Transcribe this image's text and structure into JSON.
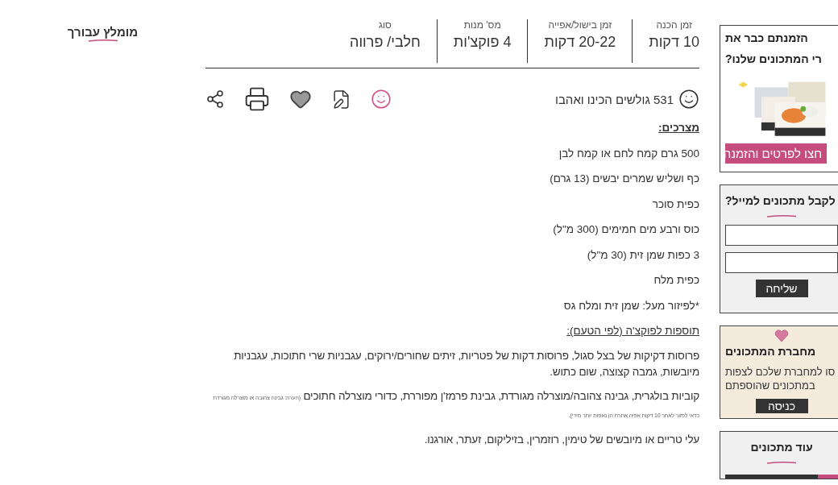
{
  "recommended": {
    "title": "מומלץ עבורך"
  },
  "stats": [
    {
      "label": "זמן הכנה",
      "value": "10 דקות"
    },
    {
      "label": "זמן בישול/אפייה",
      "value": "20-22 דקות"
    },
    {
      "label": "מס' מנות",
      "value": "4 פוקצ'ות"
    },
    {
      "label": "סוג",
      "value": "חלבי/ פרווה"
    }
  ],
  "likes": "531 גולשים הכינו ואהבו",
  "recipe": [
    {
      "kind": "heading",
      "text": "מצרכים:"
    },
    {
      "kind": "line",
      "text": "500 גרם קמח לחם או קמח לבן"
    },
    {
      "kind": "line",
      "text": "כף ושליש שמרים יבשים (13 גרם)"
    },
    {
      "kind": "line",
      "text": "כפית סוכר"
    },
    {
      "kind": "line",
      "text": "כוס ורבע מים חמימים (300 מ\"ל)"
    },
    {
      "kind": "line",
      "text": "3 כפות שמן זית (30 מ\"ל)"
    },
    {
      "kind": "line",
      "text": "כפית מלח"
    },
    {
      "kind": "line",
      "text": "*לפיזור מעל: שמן זית ומלח גס"
    },
    {
      "kind": "subheading",
      "text": "תוספות לפוקצ'ה (לפי הטעם):"
    },
    {
      "kind": "paragraph",
      "text": "פרוסות דקיקות של בצל סגול, פרוסות דקות של פטריות, זיתים שחורים/ירוקים, עגבניות שרי חתוכות, עגבניות מיובשות, גמבה קצוצה, שום כתוש."
    },
    {
      "kind": "paragraph",
      "text": "קוביות בולגרית, גבינה צהובה/מוצרלה מגורדת, גבינת פרמז'ן מפוררת, כדורי מוצרלה חתוכים",
      "note": "(הערה: גבינה צהובה או מוצרלה מגורדת כדאי לפזור לאחר 10 דקות אפיה אחרת הן נאפות יותר מידי)."
    },
    {
      "kind": "paragraph",
      "text": "עלי טריים או מיובשים של טימין, רוזמרין, בזיליקום, זעתר, אורגנו."
    }
  ],
  "sidebar": [
    {
      "kind": "promo",
      "title_lines": [
        "הזמנתם כבר את",
        "רי המתכונים שלנו?"
      ],
      "button": "חצו לפרטים והזמנה"
    },
    {
      "kind": "newsletter",
      "title": "לקבל מתכונים למייל?",
      "button": "שליחה"
    },
    {
      "kind": "notebook",
      "title": "מחברת המתכונים",
      "text_lines": [
        "סו למחברת שלכם לצפות",
        "במתכונים שהוספתם"
      ],
      "button": "כניסה"
    },
    {
      "kind": "more",
      "title": "עוד מתכונים"
    }
  ]
}
